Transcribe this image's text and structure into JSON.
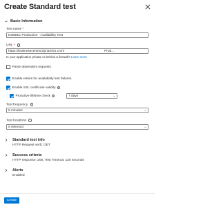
{
  "header": {
    "title": "Create Standard test"
  },
  "basic": {
    "section_title": "Basic Information",
    "test_name_label": "Test name",
    "test_name_required": "*",
    "test_name_value": "D365BC Production - Availability Test",
    "url_label": "URL",
    "url_required": "*",
    "url_value": "https://businesscentral.dynamics.com/",
    "url_value_tail": "Prod...",
    "helper_text": "Is your application private or behind a firewall?",
    "helper_link": "Learn more",
    "parse_dependent": {
      "label": "Parse dependent requests",
      "checked": false
    },
    "enable_retries": {
      "label": "Enable retries for availability test failures.",
      "checked": true
    },
    "enable_ssl": {
      "label": "Enable SSL certificate validity",
      "checked": true
    },
    "proactive": {
      "label": "Proactive lifetime check",
      "checked": true,
      "days": "7 days"
    },
    "frequency_label": "Test frequency",
    "frequency_value": "5 minutes",
    "locations_label": "Test locations",
    "locations_value": "5 selected"
  },
  "summary": {
    "test_info_title": "Standard test info",
    "test_info_value": "HTTP Request verb: GET",
    "success_title": "Success criteria",
    "success_value": "HTTP response: 200, Test Timeout: 120 seconds",
    "alerts_title": "Alerts",
    "alerts_value": "Enabled"
  },
  "footer": {
    "create_label": "Create"
  },
  "colors": {
    "accent": "#0078d4",
    "required": "#a4262c",
    "text": "#323130"
  }
}
